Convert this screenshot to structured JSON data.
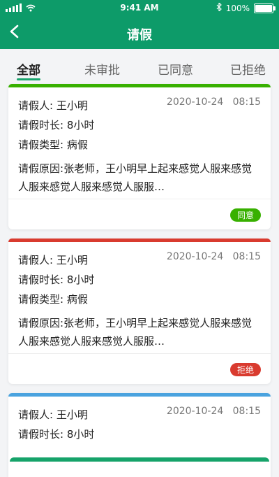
{
  "status": {
    "time": "9:41 AM",
    "battery_label": "100%",
    "battery_level": 1.0
  },
  "header": {
    "title": "请假"
  },
  "tabs": [
    {
      "label": "全部"
    },
    {
      "label": "未审批"
    },
    {
      "label": "已同意"
    },
    {
      "label": "已拒绝"
    }
  ],
  "labels": {
    "applicant": "请假人:",
    "duration": "请假时长:",
    "type": "请假类型:",
    "reason": "请假原因:"
  },
  "cards": [
    {
      "applicant": "王小明",
      "date": "2020-10-24",
      "time": "08:15",
      "duration": "8小时",
      "type": "病假",
      "reason": "张老师，王小明早上起来感觉人服来感觉人服来感觉人服来感觉人服服…",
      "status": "同意",
      "color": "#38b000"
    },
    {
      "applicant": "王小明",
      "date": "2020-10-24",
      "time": "08:15",
      "duration": "8小时",
      "type": "病假",
      "reason": "张老师，王小明早上起来感觉人服来感觉人服来感觉人服来感觉人服服…",
      "status": "拒绝",
      "color": "#d93b2f"
    },
    {
      "applicant": "王小明",
      "date": "2020-10-24",
      "time": "08:15",
      "duration": "8小时",
      "type": "",
      "reason": "",
      "status": "",
      "color": "#4aa3df"
    }
  ],
  "colors": {
    "header": "#0d9b69",
    "accent": "#1aa56e",
    "bg": "#f3f4f6"
  }
}
